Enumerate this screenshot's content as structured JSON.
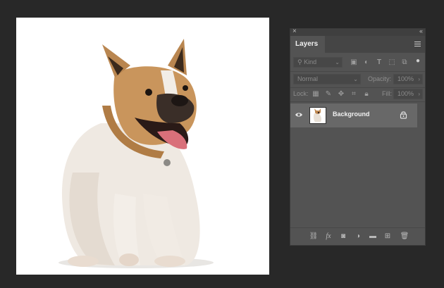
{
  "panel": {
    "close_glyph": "×",
    "collapse_glyph": "‹‹",
    "tab_label": "Layers",
    "filter": {
      "kind_placeholder": "Kind"
    },
    "blend": {
      "mode": "Normal",
      "opacity_label": "Opacity:",
      "opacity_value": "100%"
    },
    "lock": {
      "label": "Lock:",
      "fill_label": "Fill:",
      "fill_value": "100%"
    },
    "layers": [
      {
        "name": "Background",
        "visible": true,
        "locked": true
      }
    ],
    "bottom_icons": [
      "link-layers-icon",
      "fx-icon",
      "add-mask-icon",
      "adjustment-layer-icon",
      "group-folder-icon",
      "new-layer-icon",
      "trash-icon"
    ]
  },
  "colors": {
    "app_bg": "#282828",
    "panel_bg": "#535353",
    "selected_layer": "#686868",
    "canvas": "#ffffff"
  }
}
